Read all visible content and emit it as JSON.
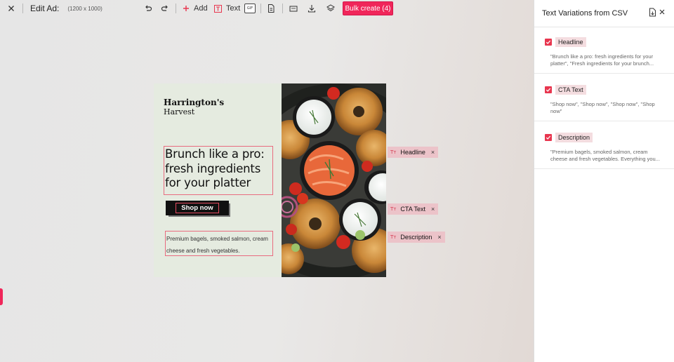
{
  "toolbar": {
    "title": "Edit Ad:",
    "dimensions": "(1200 x 1000)",
    "add_label": "Add",
    "text_label": "Text",
    "gif_label": "GIF",
    "bulk_create_label": "Bulk create (4)",
    "accent_color": "#f0265a"
  },
  "icons": [
    "close-icon",
    "undo-icon",
    "redo-icon",
    "plus-icon",
    "text-tool-icon",
    "gif-icon",
    "file-icon",
    "resize-icon",
    "download-icon",
    "layers-icon"
  ],
  "ad": {
    "brand_line1": "Harrington's",
    "brand_line2": "Harvest",
    "headline": "Brunch like a pro: fresh ingredients for your platter",
    "cta": "Shop now",
    "description": "Premium bagels, smoked salmon, cream cheese and fresh vegetables.",
    "background_color": "#e5ebe0"
  },
  "tags": {
    "icon": "Tт",
    "headline": "Headline",
    "cta": "CTA Text",
    "description": "Description",
    "close": "×"
  },
  "panel": {
    "title": "Text Variations from CSV",
    "items": [
      {
        "label": "Headline",
        "checked": true,
        "preview": "\"Brunch like a pro: fresh ingredients for your platter\", \"Fresh ingredients for your brunch..."
      },
      {
        "label": "CTA Text",
        "checked": true,
        "preview": "\"Shop now\", \"Shop now\", \"Shop now\", \"Shop now\""
      },
      {
        "label": "Description",
        "checked": true,
        "preview": "\"Premium bagels, smoked salmon, cream cheese and fresh vegetables. Everything you..."
      }
    ]
  }
}
